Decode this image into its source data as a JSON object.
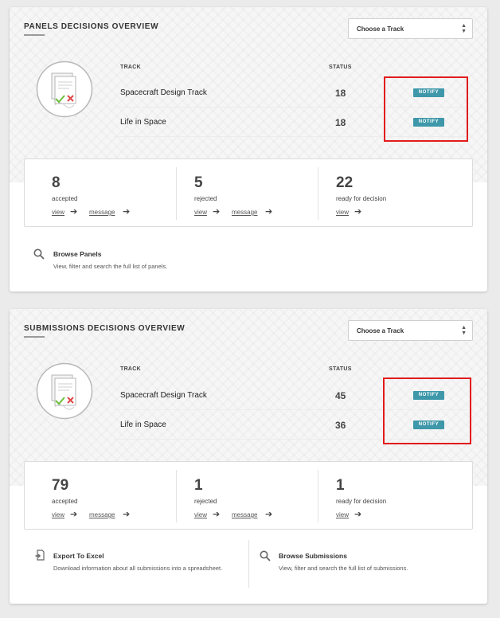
{
  "panels_overview": {
    "title": "PANELS DECISIONS OVERVIEW",
    "select_label": "Choose a Track",
    "columns": {
      "track": "TRACK",
      "status": "STATUS"
    },
    "tracks": [
      {
        "name": "Spacecraft Design Track",
        "count": "18",
        "action": "NOTIFY"
      },
      {
        "name": "Life in Space",
        "count": "18",
        "action": "NOTIFY"
      }
    ],
    "stats": [
      {
        "value": "8",
        "label": "accepted",
        "view": "view",
        "message": "message"
      },
      {
        "value": "5",
        "label": "rejected",
        "view": "view",
        "message": "message"
      },
      {
        "value": "22",
        "label": "ready for decision",
        "view": "view"
      }
    ],
    "browse": {
      "title": "Browse Panels",
      "description": "View, filter and search the full list of panels."
    }
  },
  "submissions_overview": {
    "title": "SUBMISSIONS DECISIONS OVERVIEW",
    "select_label": "Choose a Track",
    "columns": {
      "track": "TRACK",
      "status": "STATUS"
    },
    "tracks": [
      {
        "name": "Spacecraft Design Track",
        "count": "45",
        "action": "NOTIFY"
      },
      {
        "name": "Life in Space",
        "count": "36",
        "action": "NOTIFY"
      }
    ],
    "stats": [
      {
        "value": "79",
        "label": "accepted",
        "view": "view",
        "message": "message"
      },
      {
        "value": "1",
        "label": "rejected",
        "view": "view",
        "message": "message"
      },
      {
        "value": "1",
        "label": "ready for decision",
        "view": "view"
      }
    ],
    "export": {
      "title": "Export To Excel",
      "description": "Download information about all submissions into a spreadsheet."
    },
    "browse": {
      "title": "Browse Submissions",
      "description": "View, filter and search the full list of submissions."
    }
  },
  "colors": {
    "notify_button": "#3e98aa",
    "highlight": "#e21b1b",
    "check": "#6bbf3b",
    "cross": "#e04444"
  },
  "icons": {
    "document": "document-check-cross-icon",
    "search": "search-icon",
    "export": "export-icon",
    "arrow": "arrow-right-icon",
    "select": "chevron-up-down-icon"
  }
}
